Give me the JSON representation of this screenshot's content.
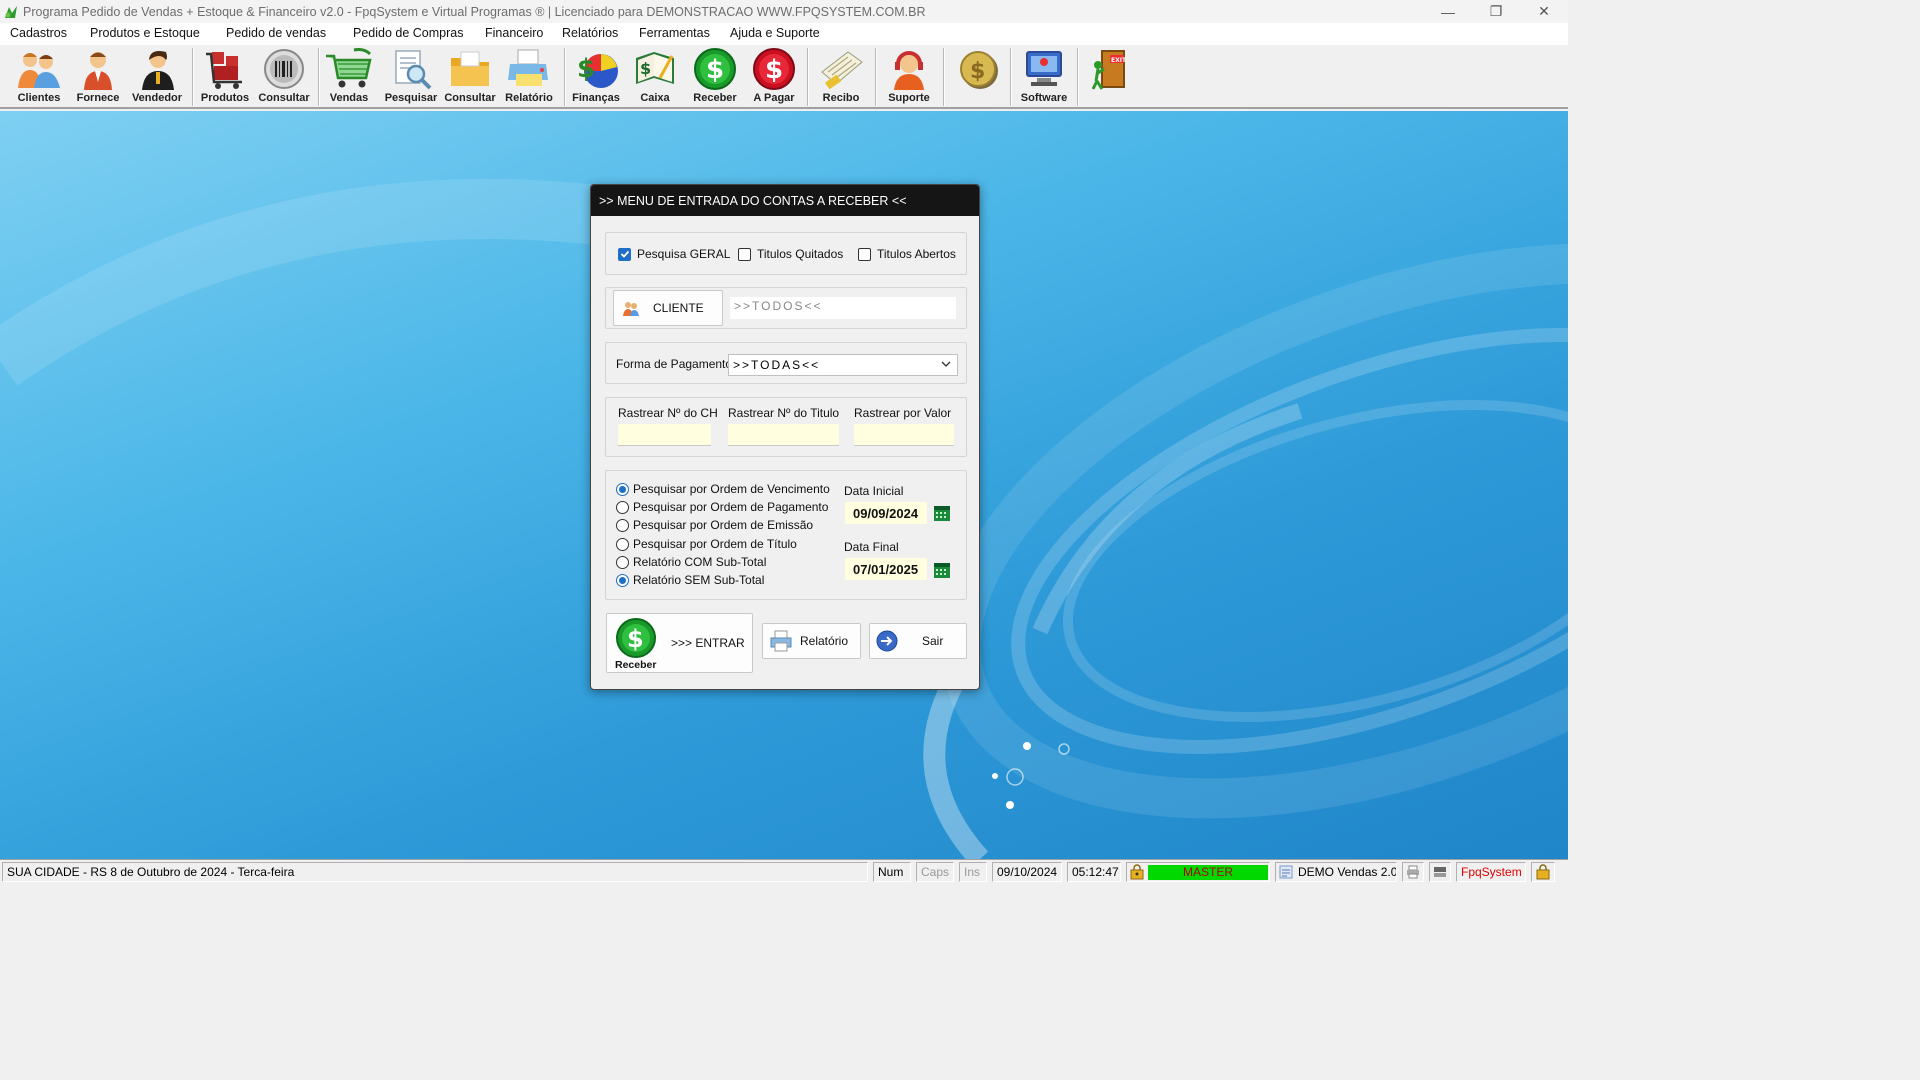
{
  "window": {
    "title": "Programa Pedido de Vendas + Estoque & Financeiro v2.0 - FpqSystem e Virtual Programas ® | Licenciado para  DEMONSTRACAO WWW.FPQSYSTEM.COM.BR",
    "minimize": "—",
    "restore": "❐",
    "close": "✕"
  },
  "menu": [
    {
      "label": "Cadastros"
    },
    {
      "label": "Produtos e Estoque"
    },
    {
      "label": "Pedido de vendas"
    },
    {
      "label": "Pedido de Compras"
    },
    {
      "label": "Financeiro"
    },
    {
      "label": "Relatórios"
    },
    {
      "label": "Ferramentas"
    },
    {
      "label": "Ajuda e Suporte"
    }
  ],
  "toolbar": [
    {
      "label": "Clientes",
      "icon": "clients-icon"
    },
    {
      "label": "Fornece",
      "icon": "supplier-icon"
    },
    {
      "label": "Vendedor",
      "icon": "seller-icon"
    },
    {
      "label": "Produtos",
      "icon": "products-icon"
    },
    {
      "label": "Consultar",
      "icon": "barcode-icon"
    },
    {
      "label": "Vendas",
      "icon": "cart-icon"
    },
    {
      "label": "Pesquisar",
      "icon": "search-doc-icon"
    },
    {
      "label": "Consultar",
      "icon": "folder-icon"
    },
    {
      "label": "Relatório",
      "icon": "printer-icon"
    },
    {
      "label": "Finanças",
      "icon": "finance-icon"
    },
    {
      "label": "Caixa",
      "icon": "cashbook-icon"
    },
    {
      "label": "Receber",
      "icon": "receive-dollar-icon"
    },
    {
      "label": "A Pagar",
      "icon": "pay-dollar-icon"
    },
    {
      "label": "Recibo",
      "icon": "receipt-icon"
    },
    {
      "label": "Suporte",
      "icon": "support-icon"
    },
    {
      "label": "",
      "icon": "coin-icon"
    },
    {
      "label": "Software",
      "icon": "software-icon"
    },
    {
      "label": "",
      "icon": "exit-door-icon"
    }
  ],
  "dialog": {
    "title": ">>  MENU DE ENTRADA DO CONTAS A RECEBER  <<",
    "checks": {
      "geral": {
        "label": "Pesquisa GERAL",
        "checked": true
      },
      "quitados": {
        "label": "Titulos Quitados",
        "checked": false
      },
      "abertos": {
        "label": "Titulos Abertos",
        "checked": false
      }
    },
    "cliente_button": "CLIENTE",
    "cliente_value": ">>TODOS<<",
    "forma_label": "Forma de Pagamento",
    "forma_value": ">>TODAS<<",
    "rastrear": {
      "ch_label": "Rastrear Nº do CH",
      "titulo_label": "Rastrear Nº do Titulo",
      "valor_label": "Rastrear por Valor"
    },
    "order_options": [
      {
        "label": "Pesquisar por Ordem de Vencimento",
        "selected": true
      },
      {
        "label": "Pesquisar por Ordem de Pagamento",
        "selected": false
      },
      {
        "label": "Pesquisar por Ordem de Emissão",
        "selected": false
      },
      {
        "label": "Pesquisar por Ordem de Título",
        "selected": false
      },
      {
        "label": "Relatório COM Sub-Total",
        "selected": false
      },
      {
        "label": "Relatório SEM Sub-Total",
        "selected": true
      }
    ],
    "data_inicial_label": "Data Inicial",
    "data_inicial": "09/09/2024",
    "data_final_label": "Data Final",
    "data_final": "07/01/2025",
    "enter_icon_label": "Receber",
    "enter_label": ">>> ENTRAR",
    "relatorio_label": "Relatório",
    "sair_label": "Sair"
  },
  "status": {
    "location": "SUA CIDADE - RS  8 de Outubro de 2024 - Terca-feira",
    "num": "Num",
    "caps": "Caps",
    "ins": "Ins",
    "date": "09/10/2024",
    "time": "05:12:47",
    "user": "MASTER",
    "version": "DEMO Vendas 2.0",
    "brand": "FpqSystem"
  },
  "colors": {
    "accent": "#1f6fc6",
    "dialog_header": "#151515",
    "status_green": "#00d800",
    "brand_red": "#e00000"
  }
}
